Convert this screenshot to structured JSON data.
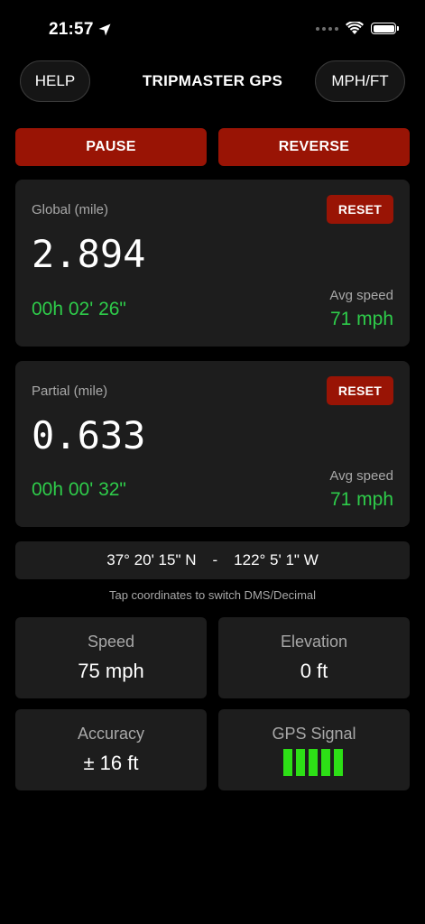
{
  "status_bar": {
    "time": "21:57",
    "location_icon": "location-arrow-icon",
    "wifi_icon": "wifi-icon",
    "battery_icon": "battery-icon"
  },
  "header": {
    "help_label": "HELP",
    "title": "TRIPMASTER GPS",
    "units_label": "MPH/FT"
  },
  "actions": {
    "pause_label": "PAUSE",
    "reverse_label": "REVERSE"
  },
  "global": {
    "label": "Global (mile)",
    "reset_label": "RESET",
    "distance": "2.894",
    "elapsed": "00h 02' 26\"",
    "avg_label": "Avg speed",
    "avg_value": "71 mph"
  },
  "partial": {
    "label": "Partial (mile)",
    "reset_label": "RESET",
    "distance": "0.633",
    "elapsed": "00h 00' 32\"",
    "avg_label": "Avg speed",
    "avg_value": "71 mph"
  },
  "coordinates": {
    "latitude": "37° 20' 15\" N",
    "separator": "-",
    "longitude": "122° 5' 1\" W",
    "hint": "Tap coordinates to switch DMS/Decimal"
  },
  "stats": {
    "speed_label": "Speed",
    "speed_value": "75 mph",
    "elevation_label": "Elevation",
    "elevation_value": "0 ft",
    "accuracy_label": "Accuracy",
    "accuracy_value": "± 16 ft",
    "gps_label": "GPS Signal",
    "gps_bars": 5,
    "gps_bars_max": 5
  },
  "colors": {
    "background": "#000000",
    "card": "#1d1d1d",
    "accent_red": "#991405",
    "accent_green": "#2ecc4a",
    "signal_green": "#2ddf16",
    "muted_text": "#a8a8a8"
  }
}
